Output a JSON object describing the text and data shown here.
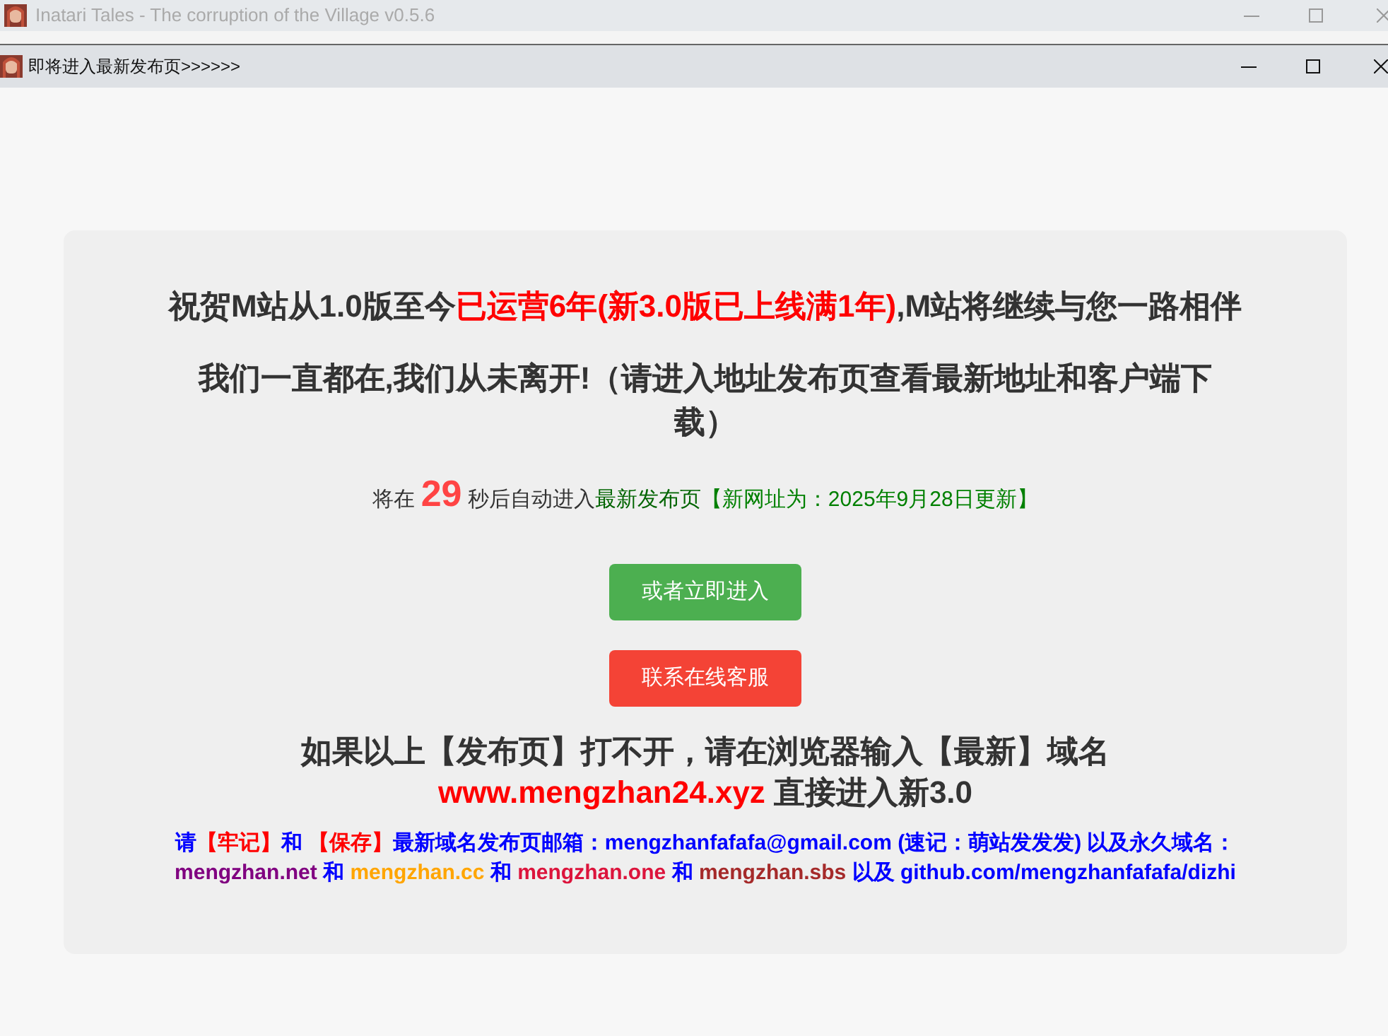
{
  "outer_window": {
    "title": "Inatari Tales - The corruption of the Village v0.5.6"
  },
  "inner_window": {
    "title": "即将进入最新发布页>>>>>>"
  },
  "notice": {
    "headline": [
      {
        "text": "祝贺M站从1.0版至今",
        "color": "#333333"
      },
      {
        "text": "已运营6年(新3.0版已上线满1年)",
        "color": "#ff0000"
      },
      {
        "text": ",M站将继续与您一路相伴",
        "color": "#333333"
      }
    ],
    "subheadline": "我们一直都在,我们从未离开!（请进入地址发布页查看最新地址和客户端下载）",
    "countdown": {
      "before": "将在",
      "seconds": "29",
      "after": "秒后自动进入",
      "link": "最新发布页",
      "note": "【新网址为：2025年9月28日更新】"
    },
    "buttons": [
      {
        "label": "或者立即进入",
        "kind": "enter"
      },
      {
        "label": "联系在线客服",
        "kind": "support"
      }
    ],
    "fallback": "如果以上【发布页】打不开，请在浏览器输入【最新】域名",
    "domain": "www.mengzhan24.xyz",
    "domain_after": "直接进入新3.0",
    "footer": [
      {
        "text": "请",
        "color": "#0000ff"
      },
      {
        "text": "【牢记】",
        "color": "#ff0000"
      },
      {
        "text": "和 ",
        "color": "#0000ff"
      },
      {
        "text": "【保存】",
        "color": "#ff0000"
      },
      {
        "text": "最新域名发布页邮箱：mengzhanfafafa@gmail.com (速记：萌站发发发) 以及永久域名：",
        "color": "#0000ff"
      },
      {
        "text": "mengzhan.net",
        "color": "#800080"
      },
      {
        "text": " 和 ",
        "color": "#0000ff"
      },
      {
        "text": "mengzhan.cc",
        "color": "#ffa500"
      },
      {
        "text": " 和 ",
        "color": "#0000ff"
      },
      {
        "text": "mengzhan.one",
        "color": "#dc143c"
      },
      {
        "text": " 和 ",
        "color": "#0000ff"
      },
      {
        "text": "mengzhan.sbs",
        "color": "#a52a2a"
      },
      {
        "text": " 以及 github.com/mengzhanfafafa/dizhi",
        "color": "#0000ff"
      }
    ]
  }
}
